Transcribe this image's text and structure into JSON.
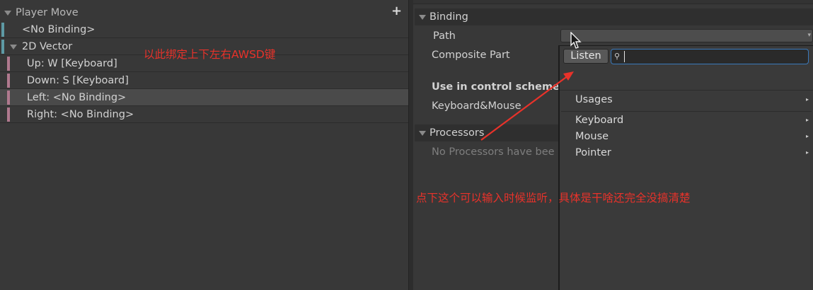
{
  "actions_tree": {
    "header": "Player Move",
    "add_icon": "plus-icon",
    "rows": [
      {
        "label": "<No Binding>"
      },
      {
        "label": "2D Vector"
      },
      {
        "label": "Up: W [Keyboard]"
      },
      {
        "label": "Down: S [Keyboard]"
      },
      {
        "label": "Left: <No Binding>"
      },
      {
        "label": "Right: <No Binding>"
      }
    ]
  },
  "properties": {
    "binding_section": "Binding",
    "path_label": "Path",
    "composite_part_label": "Composite Part",
    "control_scheme_label": "Use in control scheme",
    "control_scheme_value": "Keyboard&Mouse",
    "processors_section": "Processors",
    "processors_empty": "No Processors have bee"
  },
  "popup": {
    "listen_button": "Listen",
    "search_value": "",
    "items": [
      {
        "label": "Usages",
        "icon": "chevron-right-icon"
      },
      {
        "label": "Keyboard",
        "icon": "chevron-right-icon"
      },
      {
        "label": "Mouse",
        "icon": "chevron-right-icon"
      },
      {
        "label": "Pointer",
        "icon": "chevron-right-icon"
      }
    ]
  },
  "annotations": {
    "note_top": "以此绑定上下左右AWSD键",
    "note_bottom": "点下这个可以输入时候监听，具体是干啥还完全没搞清楚",
    "color": "#e8322a"
  },
  "colors": {
    "teal_strip": "#5e9aa5",
    "pink_strip": "#b0798e",
    "search_focus": "#3a79bb"
  }
}
